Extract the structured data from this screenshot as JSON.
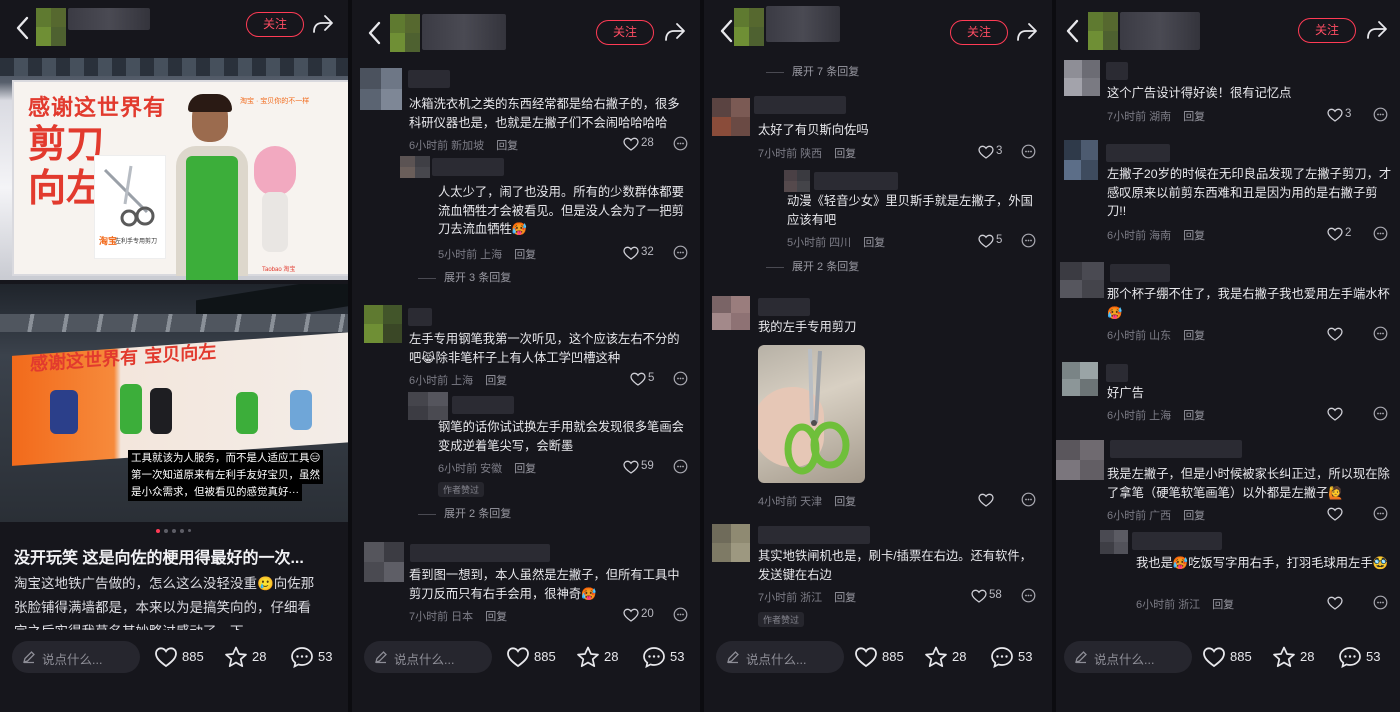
{
  "common": {
    "follow_label": "关注",
    "input_placeholder": "说点什么...",
    "likes": "885",
    "stars": "28",
    "comments": "53",
    "reply_label": "回复",
    "author_liked": "作者赞过"
  },
  "panel1": {
    "billboard_top": {
      "slogan_line1": "感谢这世界有",
      "slogan_line2": "剪刀",
      "slogan_line3": "向左",
      "brand": "淘宝",
      "tagline": "淘宝 · 宝贝你的不一样",
      "product": "左利手专用剪刀",
      "side_label": "Taobao 淘宝"
    },
    "billboard_bottom": {
      "slogan": "感谢这世界有 宝贝向左",
      "caption_line1": "工具就该为人服务，而不是人适应工具😑",
      "caption_line2": "第一次知道原来有左利手友好宝贝，虽然",
      "caption_line3": "是小众需求，但被看见的感觉真好···"
    },
    "title": "没开玩笑 这是向佐的梗用得最好的一次...",
    "body_line1": "淘宝这地铁广告做的，怎么这么没轻没重🥲向佐那",
    "body_line2": "张脸铺得满墙都是，本来以为是搞笑向的，仔细看",
    "body_line3": "完之后实得我草名其妙略过感动了一下"
  },
  "panel2": {
    "comments": [
      {
        "text": "冰箱洗衣机之类的东西经常都是给右撇子的，很多科研仪器也是，也就是左撇子们不会闹哈哈哈哈",
        "time": "6小时前 新加坡",
        "likes": "28"
      },
      {
        "text": "人太少了，闹了也没用。所有的少数群体都要流血牺牲才会被看见。但是没人会为了一把剪刀去流血牺牲🥵",
        "time": "5小时前 上海",
        "likes": "32"
      },
      {
        "text": "左手专用钢笔我第一次听见，这个应该左右不分的吧😹除非笔杆子上有人体工学凹槽这种",
        "time": "6小时前 上海",
        "likes": "5"
      },
      {
        "text": "钢笔的话你试试换左手用就会发现很多笔画会变成逆着笔尖写，会断墨",
        "time": "6小时前 安徽",
        "likes": "59"
      },
      {
        "text": "看到图一想到，本人虽然是左撇子，但所有工具中剪刀反而只有右手会用，很神奇🥵",
        "time": "7小时前 日本",
        "likes": "20"
      }
    ],
    "expand1": "展开 3 条回复",
    "expand2": "展开 2 条回复"
  },
  "panel3": {
    "expand_top": "展开 7 条回复",
    "comments": [
      {
        "text": "太好了有贝斯向佐吗",
        "time": "7小时前 陕西",
        "likes": "3"
      },
      {
        "text": "动漫《轻音少女》里贝斯手就是左撇子，外国应该有吧",
        "time": "5小时前 四川",
        "likes": "5"
      },
      {
        "text": "我的左手专用剪刀",
        "time": "4小时前 天津",
        "likes": ""
      },
      {
        "text": "其实地铁闸机也是，刷卡/插票在右边。还有软件，发送键在右边",
        "time": "7小时前 浙江",
        "likes": "58"
      }
    ],
    "expand2": "展开 2 条回复"
  },
  "panel4": {
    "comments": [
      {
        "text": "这个广告设计得好诶！很有记忆点",
        "time": "7小时前 湖南",
        "likes": "3"
      },
      {
        "text": "左撇子20岁的时候在无印良品发现了左撇子剪刀，才感叹原来以前剪东西难和丑是因为用的是右撇子剪刀!!",
        "time": "6小时前 海南",
        "likes": "2"
      },
      {
        "text": "那个杯子绷不住了，我是右撇子我也爱用左手端水杯🥵",
        "time": "6小时前 山东",
        "likes": ""
      },
      {
        "text": "好广告",
        "time": "6小时前 上海",
        "likes": ""
      },
      {
        "text": "我是左撇子，但是小时候被家长纠正过，所以现在除了拿笔（硬笔软笔画笔）以外都是左撇子🙋",
        "time": "6小时前 广西",
        "likes": ""
      },
      {
        "text": "我也是🥵吃饭写字用右手，打羽毛球用左手🥸",
        "time": "6小时前 浙江",
        "likes": ""
      }
    ]
  },
  "colors": {
    "background": "#16161c",
    "accent_red": "#ff3b55",
    "billboard_orange": "#f26a1b",
    "billboard_red": "#e23a2e",
    "apron_green": "#3cae3a"
  }
}
